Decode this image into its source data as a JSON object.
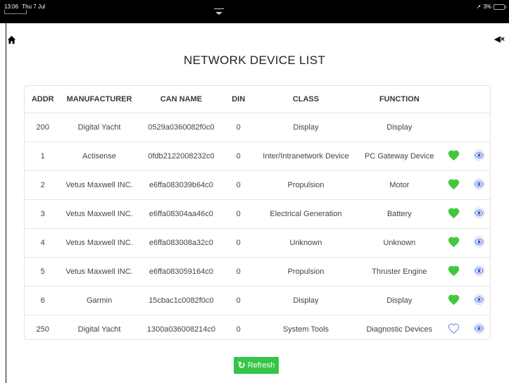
{
  "status_bar": {
    "time": "13:06",
    "date": "Thu 7 Jul",
    "battery": "3%"
  },
  "page": {
    "title": "NETWORK DEVICE LIST"
  },
  "table": {
    "headers": [
      "ADDR",
      "MANUFACTURER",
      "CAN NAME",
      "DIN",
      "CLASS",
      "FUNCTION"
    ],
    "rows": [
      {
        "addr": "200",
        "manufacturer": "Digital Yacht",
        "can_name": "0529a0360082f0c0",
        "din": "0",
        "class": "Display",
        "function": "Display",
        "actions": false,
        "favorite": false
      },
      {
        "addr": "1",
        "manufacturer": "Actisense",
        "can_name": "0fdb2122008232c0",
        "din": "0",
        "class": "Inter/Intranetwork Device",
        "function": "PC Gateway Device",
        "actions": true,
        "favorite": true
      },
      {
        "addr": "2",
        "manufacturer": "Vetus Maxwell INC.",
        "can_name": "e6ffa083039b64c0",
        "din": "0",
        "class": "Propulsion",
        "function": "Motor",
        "actions": true,
        "favorite": true
      },
      {
        "addr": "3",
        "manufacturer": "Vetus Maxwell INC.",
        "can_name": "e6ffa08304aa46c0",
        "din": "0",
        "class": "Electrical Generation",
        "function": "Battery",
        "actions": true,
        "favorite": true
      },
      {
        "addr": "4",
        "manufacturer": "Vetus Maxwell INC.",
        "can_name": "e6ffa083008a32c0",
        "din": "0",
        "class": "Unknown",
        "function": "Unknown",
        "actions": true,
        "favorite": true
      },
      {
        "addr": "5",
        "manufacturer": "Vetus Maxwell INC.",
        "can_name": "e6ffa083059164c0",
        "din": "0",
        "class": "Propulsion",
        "function": "Thruster Engine",
        "actions": true,
        "favorite": true
      },
      {
        "addr": "6",
        "manufacturer": "Garmin",
        "can_name": "15cbac1c0082f0c0",
        "din": "0",
        "class": "Display",
        "function": "Display",
        "actions": true,
        "favorite": true
      },
      {
        "addr": "250",
        "manufacturer": "Digital Yacht",
        "can_name": "1300a036008214c0",
        "din": "0",
        "class": "System Tools",
        "function": "Diagnostic Devices",
        "actions": true,
        "favorite": false
      }
    ]
  },
  "refresh_button": {
    "label": "Refresh"
  },
  "colors": {
    "heart": "#43c83c",
    "eye": "#3a5fd9",
    "refresh": "#33c548"
  },
  "icons": {
    "home": "home-icon",
    "mute": "speaker-mute-icon",
    "favorite": "heart-icon",
    "view": "eye-icon",
    "refresh": "refresh-icon"
  }
}
